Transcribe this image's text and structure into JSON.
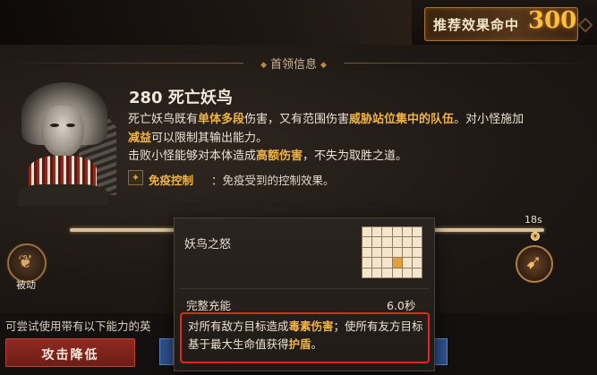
{
  "header": {
    "recommend_label": "推荐效果命中",
    "recommend_value": "300"
  },
  "section": {
    "title": "首领信息"
  },
  "boss": {
    "name": "280 死亡妖鸟",
    "desc_line1_a": "死亡妖鸟既有",
    "desc_line1_hl1": "单体多段",
    "desc_line1_b": "伤害，又有范围伤害",
    "desc_line1_hl2": "威胁站位集中的队伍",
    "desc_line1_c": "。对小怪施加",
    "desc_line2_hl": "减益",
    "desc_line2_a": "可以限制其输出能力。",
    "desc_line3_a": "击败小怪能够对本体造成",
    "desc_line3_hl": "高额伤害",
    "desc_line3_b": "，不失为取胜之道。",
    "immune_label": "免疫控制",
    "immune_text": "：免疫受到的控制效果。"
  },
  "timeline": {
    "time_label": "18s",
    "passive_label": "被动"
  },
  "popup": {
    "title": "妖鸟之怒",
    "charge_label": "完整充能",
    "charge_value": "6.0秒",
    "effect_a": "对所有敌方目标造成",
    "effect_hl1": "毒素伤害",
    "effect_b": "；使所有友方目标基于最大生命值获得",
    "effect_hl2": "护盾",
    "effect_c": "。",
    "grid_highlight": [
      [
        3,
        3
      ]
    ]
  },
  "bottom": {
    "try_text": "可尝试使用带有以下能力的英",
    "attack_button": "攻击降低"
  },
  "colors": {
    "highlight": "#f0b444",
    "accent_number": "#ffbf3c",
    "effect_border": "#e3261f",
    "attack_button": "#8e2a22"
  }
}
